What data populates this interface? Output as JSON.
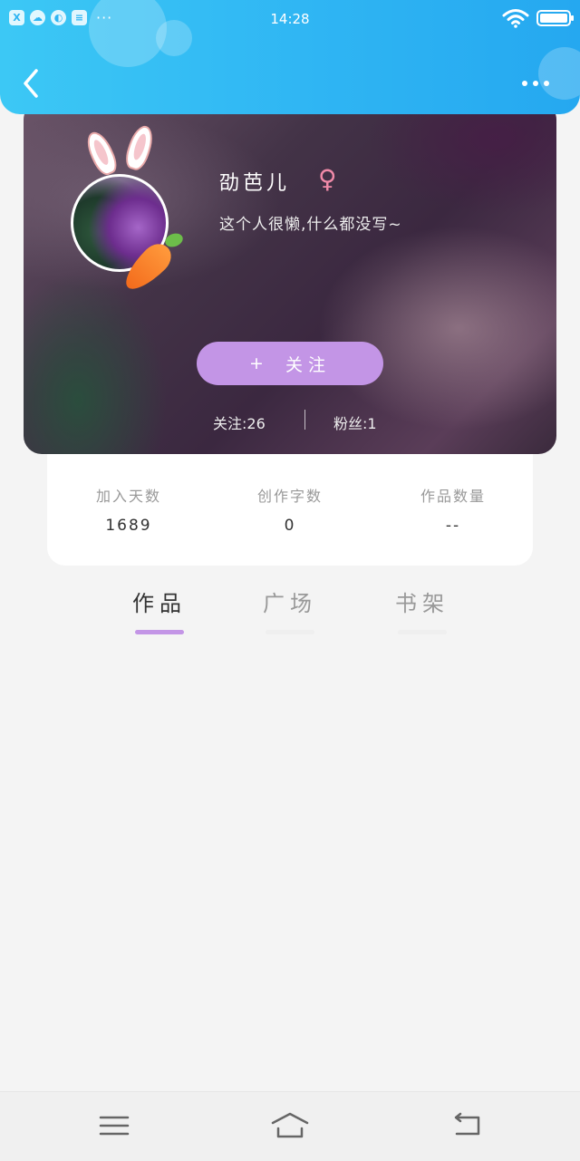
{
  "status_bar": {
    "time": "14:28",
    "left_icons": [
      "excel-icon",
      "cloud-icon",
      "browser-icon",
      "storage-icon"
    ],
    "more": "···"
  },
  "header": {
    "back_icon": "chevron-left-icon",
    "more_icon": "more-dots-icon"
  },
  "profile": {
    "username": "劭芭儿",
    "gender_symbol": "♀",
    "bio": "这个人很懒,什么都没写~",
    "follow_plus": "+",
    "follow_label": "关注",
    "following": "关注:26",
    "fans": "粉丝:1"
  },
  "info": [
    {
      "label": "加入天数",
      "value": "1689"
    },
    {
      "label": "创作字数",
      "value": "0"
    },
    {
      "label": "作品数量",
      "value": "--"
    }
  ],
  "tabs": [
    {
      "label": "作品",
      "active": true
    },
    {
      "label": "广场",
      "active": false
    },
    {
      "label": "书架",
      "active": false
    }
  ],
  "nav_bar": {
    "menu_icon": "menu-icon",
    "home_icon": "home-icon",
    "back_icon": "return-icon"
  },
  "colors": {
    "header": "#2fb5f3",
    "accent": "#c395e6",
    "gender": "#f08aa8"
  }
}
